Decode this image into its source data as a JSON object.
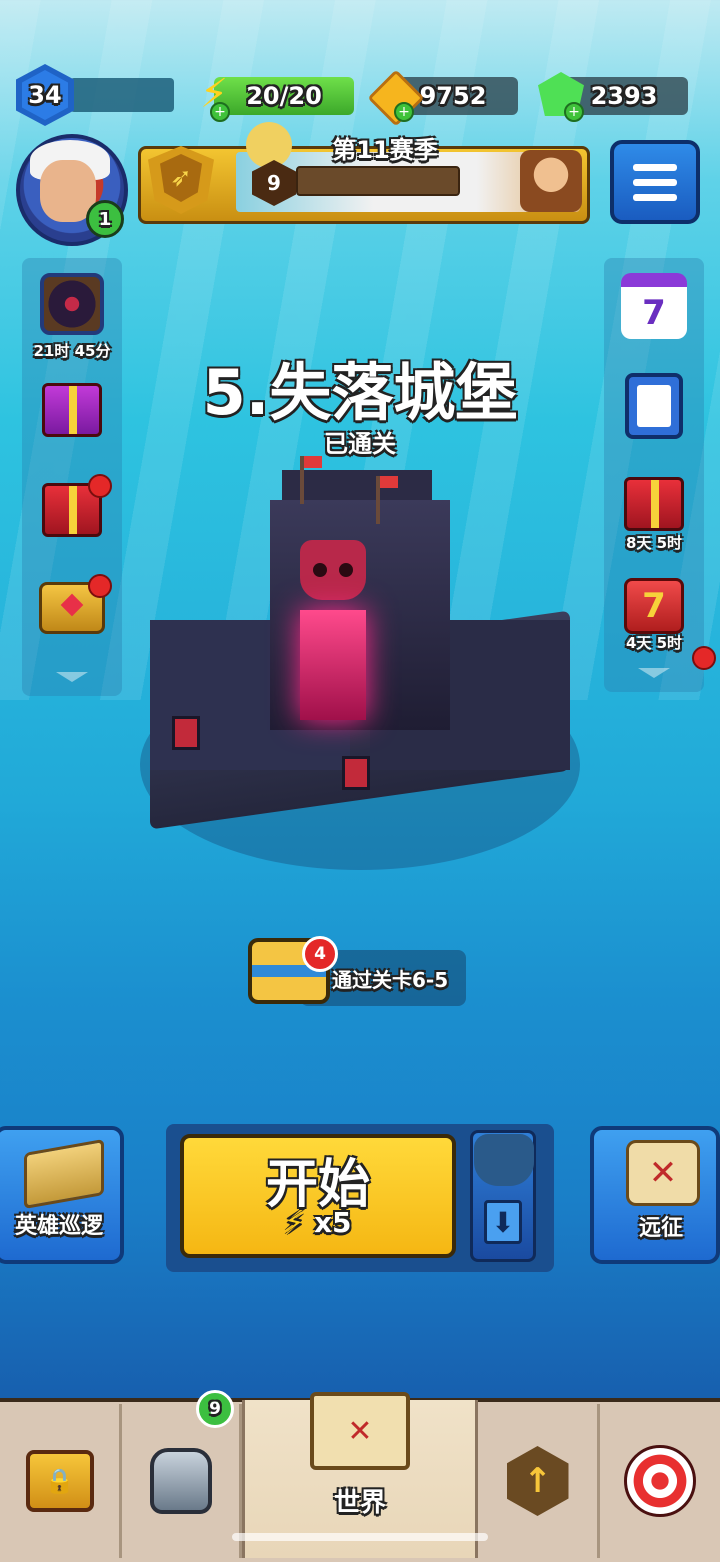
{
  "hud": {
    "player_level": "34",
    "energy": "20/20",
    "gold": "9752",
    "gems": "2393"
  },
  "profile": {
    "badge_count": "1"
  },
  "season": {
    "title": "第11赛季",
    "tier": "9"
  },
  "left_events": [
    {
      "name": "portal-event",
      "timer": "21时 45分"
    },
    {
      "name": "gift-bundle"
    },
    {
      "name": "red-gift",
      "has_dot": true
    },
    {
      "name": "ruby-chest",
      "has_dot": true
    }
  ],
  "right_events": [
    {
      "name": "calendar",
      "digit": "7"
    },
    {
      "name": "quests"
    },
    {
      "name": "gift-pack",
      "timer": "8天 5时"
    },
    {
      "name": "lucky-seven",
      "digit": "7",
      "timer": "4天 5时"
    }
  ],
  "stage": {
    "title": "5.失落城堡",
    "status": "已通关"
  },
  "reward": {
    "badge": "4",
    "text": "通过关卡6-5"
  },
  "actions": {
    "patrol_label": "英雄巡逻",
    "start_label": "开始",
    "start_cost": "x5",
    "expedition_label": "远征"
  },
  "nav": {
    "world_label": "世界",
    "equipment_badge": "9"
  },
  "colors": {
    "accent_yellow": "#f5b713",
    "energy_green": "#3ca82a",
    "sea_blue": "#1b8fcf"
  }
}
